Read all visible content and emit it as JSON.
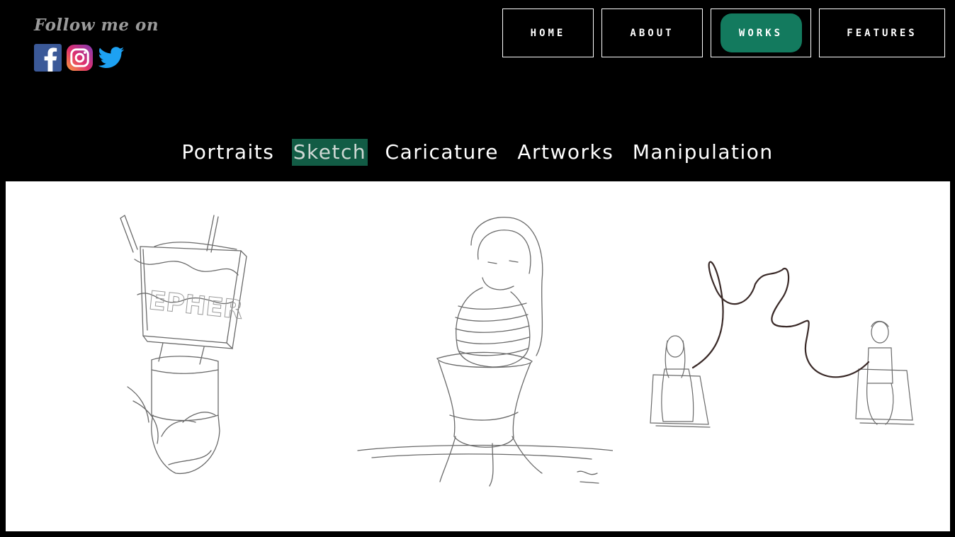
{
  "header": {
    "follow_text": "Follow me on",
    "social": [
      {
        "name": "facebook-icon",
        "color": "#3b5998"
      },
      {
        "name": "instagram-icon",
        "color": "#c13584"
      },
      {
        "name": "twitter-icon",
        "color": "#1da1f2"
      }
    ]
  },
  "nav": {
    "items": [
      {
        "label": "HOME",
        "active": false
      },
      {
        "label": "ABOUT",
        "active": false
      },
      {
        "label": "WORKS",
        "active": true
      },
      {
        "label": "FEATURES",
        "active": false
      }
    ]
  },
  "categories": {
    "items": [
      {
        "label": "Portraits",
        "active": false
      },
      {
        "label": "Sketch",
        "active": true
      },
      {
        "label": "Caricature",
        "active": false
      },
      {
        "label": "Artworks",
        "active": false
      },
      {
        "label": "Manipulation",
        "active": false
      }
    ]
  },
  "gallery": {
    "images": [
      {
        "name": "sketch-image-book-plant",
        "signboard_text": "EPHER"
      },
      {
        "name": "sketch-image-girl-vase"
      },
      {
        "name": "sketch-image-couple-string"
      }
    ]
  },
  "colors": {
    "accent": "#137a5e",
    "category_active_bg": "#125c45",
    "background": "#000000",
    "gallery_bg": "#ffffff"
  }
}
